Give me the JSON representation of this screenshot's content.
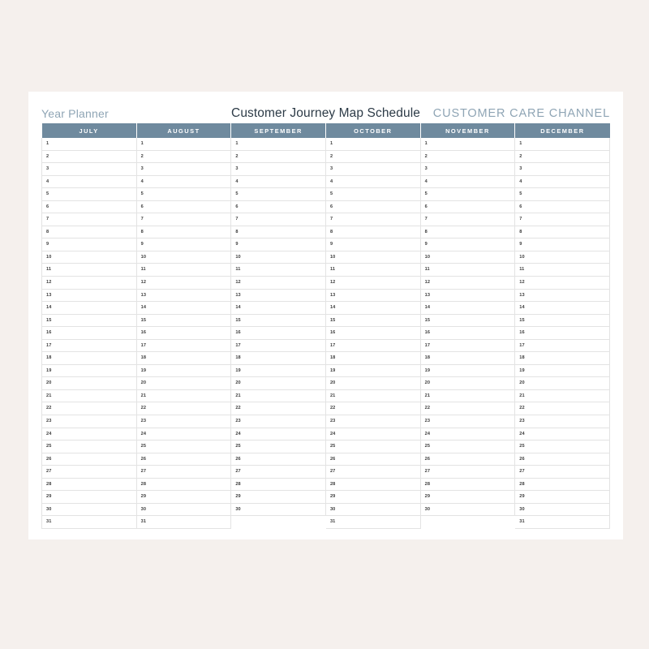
{
  "page": {
    "background_color": "#f5f0ed",
    "card_background_color": "#ffffff"
  },
  "header": {
    "brand_label": "Year Planner",
    "title": "Customer Journey Map Schedule",
    "channel_label": "CUSTOMER CARE CHANNEL",
    "brand_color": "#8fa5b5",
    "title_color": "#2d3b47",
    "channel_color": "#8fa5b5"
  },
  "table": {
    "header_background_color": "#6f8a9e",
    "header_text_color": "#ffffff",
    "grid_line_color": "#e3e3e3",
    "day_text_color": "#3d3d3d",
    "row_count": 31,
    "columns": [
      {
        "label": "JULY",
        "days": 31
      },
      {
        "label": "AUGUST",
        "days": 31
      },
      {
        "label": "SEPTEMBER",
        "days": 30
      },
      {
        "label": "OCTOBER",
        "days": 31
      },
      {
        "label": "NOVEMBER",
        "days": 30
      },
      {
        "label": "DECEMBER",
        "days": 31
      }
    ],
    "day_numbers": [
      "1",
      "2",
      "3",
      "4",
      "5",
      "6",
      "7",
      "8",
      "9",
      "10",
      "11",
      "12",
      "13",
      "14",
      "15",
      "16",
      "17",
      "18",
      "19",
      "20",
      "21",
      "22",
      "23",
      "24",
      "25",
      "26",
      "27",
      "28",
      "29",
      "30",
      "31"
    ]
  }
}
